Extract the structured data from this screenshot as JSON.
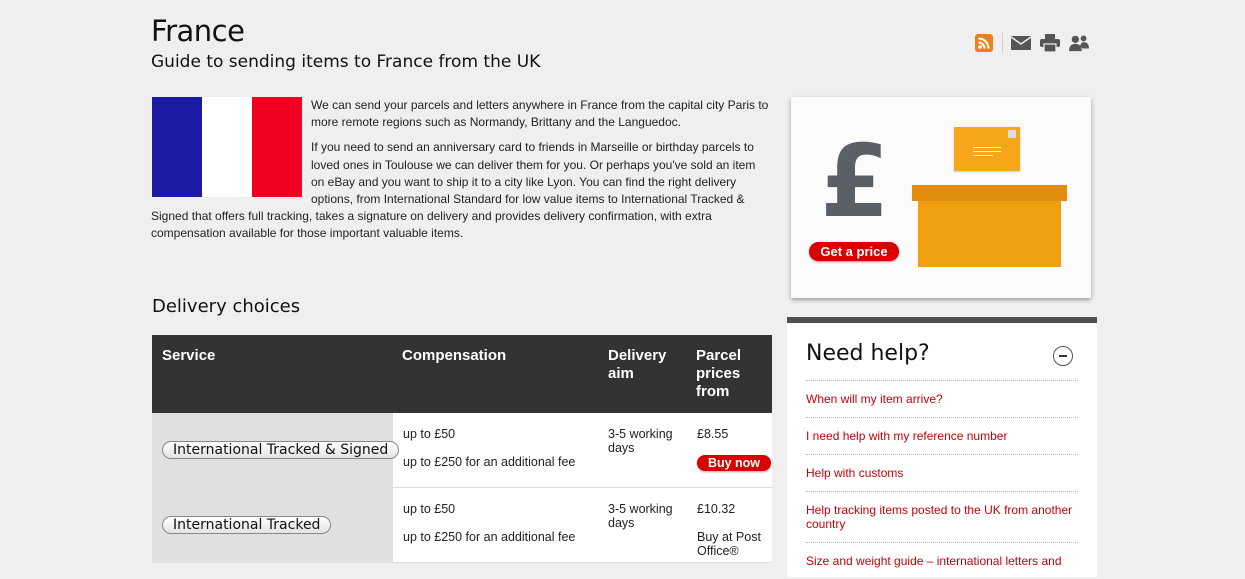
{
  "header": {
    "title": "France",
    "subtitle": "Guide to sending items to France from the UK"
  },
  "toolbar": {
    "icons": [
      "rss-icon",
      "email-icon",
      "print-icon",
      "share-icon"
    ],
    "rss_color": "#f0801a",
    "icon_color": "#555555"
  },
  "flag": {
    "colors": [
      "#1a1aa3",
      "#ffffff",
      "#f0001e"
    ]
  },
  "intro": {
    "p1": "We can send your parcels and letters anywhere in France from the capital city Paris to more remote regions such as Normandy, Brittany and the Languedoc.",
    "p2": "If you need to send an anniversary card to friends in Marseille or birthday parcels to loved ones in Toulouse we can deliver them for you. Or perhaps you've sold an item on eBay and you want to ship it to a city like Lyon. You can find the right delivery options, from International Standard for low value items to International Tracked & Signed that offers full tracking, takes a signature on delivery and provides delivery confirmation, with extra compensation available for those important valuable items."
  },
  "promo": {
    "symbol": "£",
    "button_label": "Get a price"
  },
  "delivery": {
    "heading": "Delivery choices",
    "columns": {
      "service": "Service",
      "compensation": "Compensation",
      "delivery_aim": "Delivery aim",
      "price": "Parcel prices from"
    },
    "rows": [
      {
        "service": "International Tracked & Signed",
        "comp1": "up to £50",
        "comp2": "up to £250 for an additional fee",
        "aim": "3-5 working days",
        "price": "£8.55",
        "action": "Buy now"
      },
      {
        "service": "International Tracked",
        "comp1": "up to £50",
        "comp2": "up to £250 for an additional fee",
        "aim": "3-5 working days",
        "price": "£10.32",
        "action": "Buy at Post Office®"
      }
    ]
  },
  "help": {
    "title": "Need help?",
    "links": [
      "When will my item arrive?",
      "I need help with my reference number",
      "Help with customs",
      "Help tracking items posted to the UK from another country",
      "Size and weight guide – international letters and"
    ]
  }
}
